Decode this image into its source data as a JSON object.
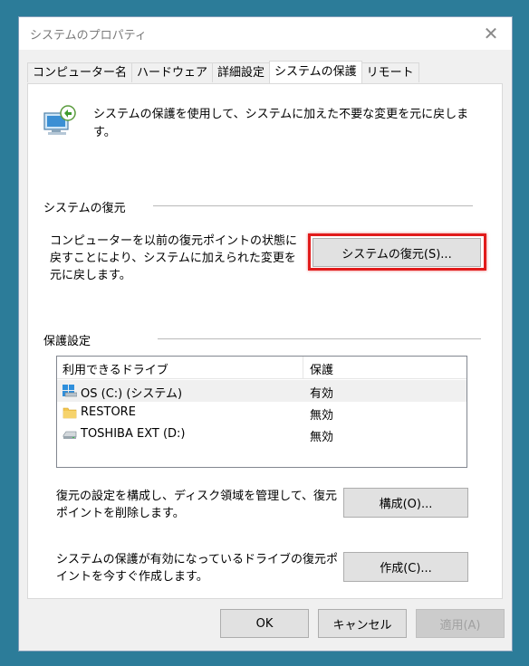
{
  "window": {
    "title": "システムのプロパティ",
    "close_glyph": "✕"
  },
  "tabs": [
    {
      "label": "コンピューター名",
      "active": false
    },
    {
      "label": "ハードウェア",
      "active": false
    },
    {
      "label": "詳細設定",
      "active": false
    },
    {
      "label": "システムの保護",
      "active": true
    },
    {
      "label": "リモート",
      "active": false
    }
  ],
  "intro_text": "システムの保護を使用して、システムに加えた不要な変更を元に戻します。",
  "restore_group": {
    "label": "システムの復元",
    "description": "コンピューターを以前の復元ポイントの状態に戻すことにより、システムに加えられた変更を元に戻します。",
    "button_label": "システムの復元(S)..."
  },
  "protection_group": {
    "label": "保護設定",
    "columns": [
      "利用できるドライブ",
      "保護"
    ],
    "drives": [
      {
        "name": "OS (C:) (システム)",
        "status": "有効",
        "icon": "system-drive-icon",
        "selected": true
      },
      {
        "name": "RESTORE",
        "status": "無効",
        "icon": "folder-icon",
        "selected": false
      },
      {
        "name": "TOSHIBA EXT (D:)",
        "status": "無効",
        "icon": "drive-icon",
        "selected": false
      }
    ],
    "configure_text": "復元の設定を構成し、ディスク領域を管理して、復元ポイントを削除します。",
    "configure_button": "構成(O)...",
    "create_text": "システムの保護が有効になっているドライブの復元ポイントを今すぐ作成します。",
    "create_button": "作成(C)..."
  },
  "footer": {
    "ok": "OK",
    "cancel": "キャンセル",
    "apply": "適用(A)"
  },
  "colors": {
    "desktop": "#2c7c99",
    "highlight": "#e11b1b"
  }
}
